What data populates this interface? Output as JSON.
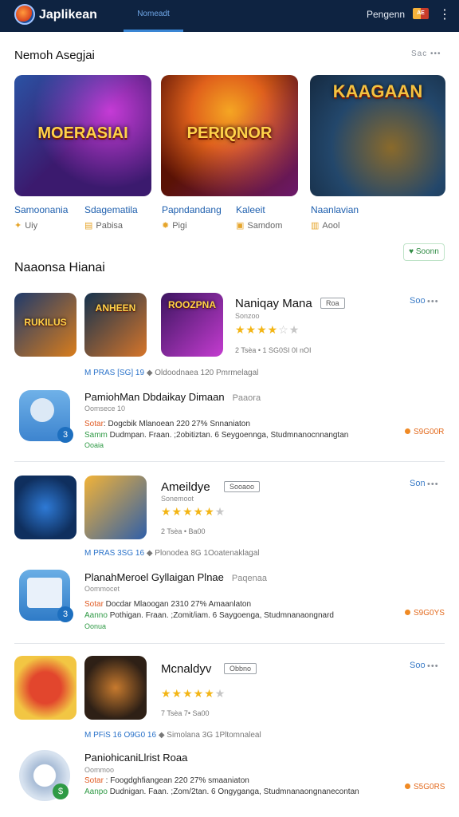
{
  "header": {
    "app_title": "Japlikean",
    "active_tab": "Nomeadt",
    "user_name": "Pengenn",
    "flag_label": "AE"
  },
  "section1": {
    "title": "Nemoh Asegjai",
    "more": "Sac •••",
    "cards": [
      {
        "banner": "MOERASIAI",
        "name": "Samoonania",
        "sub": "Uiy",
        "colors": [
          "#3b1a6e",
          "#c53bd6",
          "#1a8bd9"
        ]
      },
      {
        "banner": "PERIQNOR",
        "name": "Sdagematila",
        "sub": "Pabisa",
        "colors": [
          "#5a1205",
          "#e0611b",
          "#7b1fbf"
        ]
      },
      {
        "banner": "",
        "name": "Papndandang",
        "sub": "Pigi",
        "colors": [
          "#23476b",
          "#e77b2a",
          "#152a41"
        ]
      },
      {
        "banner": "KAAGAAN",
        "name": "Kaleeit",
        "sub": "Samdom",
        "colors": [
          "#1c5d96",
          "#8a6a2b",
          "#1a2538"
        ]
      },
      {
        "banner": "",
        "name": "Naanlavian",
        "sub": "Aool",
        "colors": []
      }
    ]
  },
  "filter_button": "Soonn",
  "section2": {
    "title": "Naaonsa Hianai",
    "rows": [
      {
        "thumbs": [
          {
            "label": "RUKILUS",
            "colors": [
              "#1f3a6b",
              "#d97d1c"
            ]
          },
          {
            "label": "ANHEEN",
            "colors": [
              "#15324e",
              "#d6752a"
            ]
          },
          {
            "label": "ROOZPNA",
            "colors": [
              "#3c1560",
              "#c43cd0"
            ]
          }
        ],
        "title": "Naniqay Mana",
        "tag": "Roa",
        "sub": "Sonzoo",
        "rating": 4,
        "meta": "2 Tsèa • 1 SG0SI 0I nOI",
        "link_a": "M PRAS [SG] 19",
        "link_b": "Oldoodnaea 120 Pmrmelagal",
        "price": "Soo",
        "detail": {
          "title": "PamiohMan Dbdaikay Dimaan",
          "extra": "Paaora",
          "sub": "Oomsece 10",
          "line1_key": "Sotar",
          "line1": ": Dogcbik Mlanoean 220 27%  Snnaniaton",
          "line2_key": "Samm",
          "line2": " Dudmpan. Fraan. ;2obitiztan. 6 Seygoennga, Studmnanocnnangtan",
          "line3": "Ooaia",
          "price": "S9G00R",
          "badge": "3",
          "icon_color": "#5f9fdb"
        }
      },
      {
        "thumbs": [
          {
            "label": "",
            "colors": [
              "#0f2f5e",
              "#2e7ad6"
            ]
          },
          {
            "label": "",
            "colors": [
              "#c67a1a",
              "#2f5fa8"
            ]
          }
        ],
        "title": "Ameildye",
        "tag": "Sooaoo",
        "sub": "Sonemoot",
        "rating": 5,
        "meta": "2 Tsèa • Ba00",
        "link_a": "M PRAS 3SG 16",
        "link_b": "Plonodea 8G 1Ooatenaklagal",
        "price": "Son",
        "detail": {
          "title": "PlanahMeroel Gyllaigan Plnae",
          "extra": "Paqenaa",
          "sub": "Oommocet",
          "line1_key": "Sotar",
          "line1": " Docdar Mlaoogan 2310 27%   Amaanlaton",
          "line2_key": "Aanno",
          "line2": " Pothigan. Fraan. ;Zomit/iam. 6 Saygoenga, Studmnanaongnard",
          "line3": "Oonua",
          "price": "S9G0YS",
          "badge": "3",
          "icon_color": "#2f7bc7"
        }
      },
      {
        "thumbs": [
          {
            "label": "",
            "colors": [
              "#f2c643",
              "#e2462d"
            ]
          },
          {
            "label": "",
            "colors": [
              "#2e2016",
              "#c77a2e"
            ]
          }
        ],
        "title": "Mcnaldyv",
        "tag": "Obbno",
        "sub": "",
        "rating": 5,
        "meta": "7 Tsèa 7• Sa00",
        "link_a": "M PFiS 16 O9G0 16",
        "link_b": "Simolana 3G 1Pltomnaleal",
        "price": "Soo",
        "detail": {
          "title": "PaniohicaniLlrist Roaa",
          "extra": "",
          "sub": "Oommoo",
          "line1_key": "Sotar",
          "line1": " : Foogdghfiangean 220 27%  smaaniaton",
          "line2_key": "Aanpo",
          "line2": " Dudnigan. Faan. ;Zom/2tan. 6 Ongyganga, Studmnanaongnanecontan",
          "line3": "",
          "price": "S5G0RS",
          "badge": "",
          "icon_color": "#8fa6c4"
        }
      }
    ]
  }
}
